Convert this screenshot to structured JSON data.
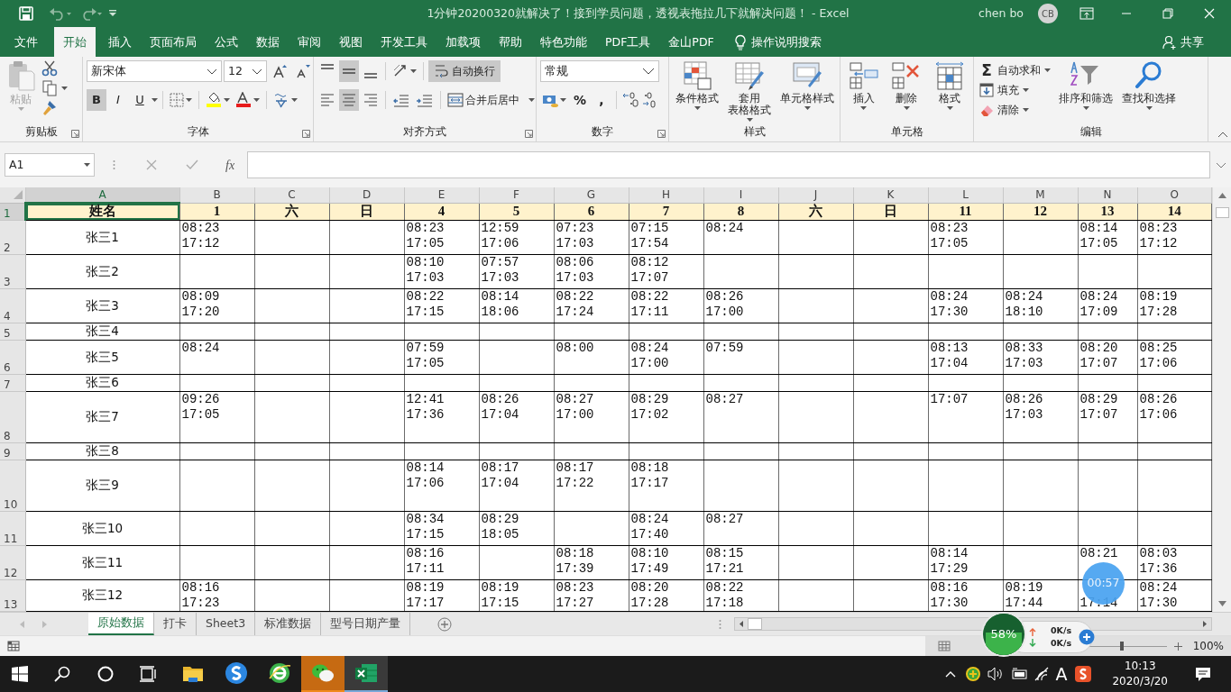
{
  "title_bar": {
    "title": "1分钟20200320就解决了！接到学员问题，透视表拖拉几下就解决问题！  -  Excel",
    "user_name": "chen bo",
    "avatar_initials": "CB"
  },
  "ribbon_tabs": [
    {
      "label": "文件",
      "selected": false
    },
    {
      "label": "开始",
      "selected": true
    },
    {
      "label": "插入",
      "selected": false
    },
    {
      "label": "页面布局",
      "selected": false
    },
    {
      "label": "公式",
      "selected": false
    },
    {
      "label": "数据",
      "selected": false
    },
    {
      "label": "审阅",
      "selected": false
    },
    {
      "label": "视图",
      "selected": false
    },
    {
      "label": "开发工具",
      "selected": false
    },
    {
      "label": "加载项",
      "selected": false
    },
    {
      "label": "帮助",
      "selected": false
    },
    {
      "label": "特色功能",
      "selected": false
    },
    {
      "label": "PDF工具",
      "selected": false
    },
    {
      "label": "金山PDF",
      "selected": false
    }
  ],
  "tell_me": "操作说明搜索",
  "share": "共享",
  "ribbon": {
    "clipboard": {
      "label": "剪贴板",
      "paste": {
        "label": "粘贴",
        "disabled": true
      }
    },
    "font": {
      "label": "字体",
      "font_name": "新宋体",
      "font_size": "12",
      "styles": [
        {
          "label": "B",
          "selected": true
        },
        {
          "label": "I",
          "selected": false
        },
        {
          "label": "U",
          "selected": false
        }
      ]
    },
    "alignment": {
      "label": "对齐方式",
      "vertical": [
        {
          "selected": false
        },
        {
          "selected": true
        },
        {
          "selected": false
        }
      ],
      "horizontal": [
        {
          "selected": false
        },
        {
          "selected": true
        },
        {
          "selected": false
        }
      ],
      "wrap_text": {
        "label": "自动换行",
        "selected": true
      },
      "merge": "合并后居中"
    },
    "number": {
      "label": "数字",
      "format": "常规",
      "symbols": [
        "%",
        ","
      ]
    },
    "styles": {
      "label": "样式",
      "buttons": [
        [
          "条件格式"
        ],
        [
          "套用",
          "表格格式"
        ],
        [
          "单元格样式"
        ]
      ]
    },
    "cells": {
      "label": "单元格",
      "buttons": [
        [
          "插入"
        ],
        [
          "删除"
        ],
        [
          "格式"
        ]
      ]
    },
    "editing": {
      "label": "编辑",
      "small_buttons": [
        {
          "symbol": "Σ",
          "label": "自动求和"
        },
        {
          "label": "填充"
        },
        {
          "label": "清除"
        }
      ],
      "buttons": [
        [
          "排序和筛选"
        ],
        [
          "查找和选择"
        ]
      ]
    }
  },
  "formula_bar": {
    "name_box": "A1",
    "function_label": "fx"
  },
  "sheet": {
    "columns": [
      {
        "letter": "A",
        "selected": true
      },
      {
        "letter": "B",
        "selected": false
      },
      {
        "letter": "C",
        "selected": false
      },
      {
        "letter": "D",
        "selected": false
      },
      {
        "letter": "E",
        "selected": false
      },
      {
        "letter": "F",
        "selected": false
      },
      {
        "letter": "G",
        "selected": false
      },
      {
        "letter": "H",
        "selected": false
      },
      {
        "letter": "I",
        "selected": false
      },
      {
        "letter": "J",
        "selected": false
      },
      {
        "letter": "K",
        "selected": false
      },
      {
        "letter": "L",
        "selected": false
      },
      {
        "letter": "M",
        "selected": false
      },
      {
        "letter": "N",
        "selected": false
      },
      {
        "letter": "O",
        "selected": false
      }
    ],
    "rows": [
      {
        "number": "1",
        "selected": true,
        "kind": "header",
        "cells": [
          [
            "姓名"
          ],
          [
            "1"
          ],
          [
            "六"
          ],
          [
            "日"
          ],
          [
            "4"
          ],
          [
            "5"
          ],
          [
            "6"
          ],
          [
            "7"
          ],
          [
            "8"
          ],
          [
            "六"
          ],
          [
            "日"
          ],
          [
            "11"
          ],
          [
            "12"
          ],
          [
            "13"
          ],
          [
            "14"
          ]
        ]
      },
      {
        "number": "2",
        "selected": false,
        "kind": "data",
        "cells": [
          [
            "张三1"
          ],
          [
            "08:23",
            "17:12"
          ],
          null,
          null,
          [
            "08:23",
            "17:05"
          ],
          [
            "12:59",
            "17:06"
          ],
          [
            "07:23",
            "17:03"
          ],
          [
            "07:15",
            "17:54"
          ],
          [
            "08:24"
          ],
          null,
          null,
          [
            "08:23",
            "17:05"
          ],
          null,
          [
            "08:14",
            "17:05"
          ],
          [
            "08:23",
            "17:12"
          ]
        ]
      },
      {
        "number": "3",
        "selected": false,
        "kind": "data",
        "cells": [
          [
            "张三2"
          ],
          null,
          null,
          null,
          [
            "08:10",
            "17:03"
          ],
          [
            "07:57",
            "17:03"
          ],
          [
            "08:06",
            "17:03"
          ],
          [
            "08:12",
            "17:07"
          ],
          null,
          null,
          null,
          null,
          null,
          null,
          null
        ]
      },
      {
        "number": "4",
        "selected": false,
        "kind": "data",
        "cells": [
          [
            "张三3"
          ],
          [
            "08:09",
            "17:20"
          ],
          null,
          null,
          [
            "08:22",
            "17:15"
          ],
          [
            "08:14",
            "18:06"
          ],
          [
            "08:22",
            "17:24"
          ],
          [
            "08:22",
            "17:11"
          ],
          [
            "08:26",
            "17:00"
          ],
          null,
          null,
          [
            "08:24",
            "17:30"
          ],
          [
            "08:24",
            "18:10"
          ],
          [
            "08:24",
            "17:09"
          ],
          [
            "08:19",
            "17:28"
          ]
        ]
      },
      {
        "number": "5",
        "selected": false,
        "kind": "data",
        "cells": [
          [
            "张三4"
          ],
          null,
          null,
          null,
          null,
          null,
          null,
          null,
          null,
          null,
          null,
          null,
          null,
          null,
          null
        ]
      },
      {
        "number": "6",
        "selected": false,
        "kind": "data",
        "cells": [
          [
            "张三5"
          ],
          [
            "08:24"
          ],
          null,
          null,
          [
            "07:59",
            "17:05"
          ],
          null,
          [
            "08:00"
          ],
          [
            "08:24",
            "17:00"
          ],
          [
            "07:59"
          ],
          null,
          null,
          [
            "08:13",
            "17:04"
          ],
          [
            "08:33",
            "17:03"
          ],
          [
            "08:20",
            "17:07"
          ],
          [
            "08:25",
            "17:06"
          ]
        ]
      },
      {
        "number": "7",
        "selected": false,
        "kind": "data",
        "cells": [
          [
            "张三6"
          ],
          null,
          null,
          null,
          null,
          null,
          null,
          null,
          null,
          null,
          null,
          null,
          null,
          null,
          null
        ]
      },
      {
        "number": "8",
        "selected": false,
        "kind": "data",
        "cells": [
          [
            "张三7"
          ],
          [
            "09:26",
            "17:05"
          ],
          null,
          null,
          [
            "12:41",
            "17:36"
          ],
          [
            "08:26",
            "17:04"
          ],
          [
            "08:27",
            "17:00"
          ],
          [
            "08:29",
            "17:02"
          ],
          [
            "08:27"
          ],
          null,
          null,
          [
            "17:07"
          ],
          [
            "08:26",
            "17:03"
          ],
          [
            "08:29",
            "17:07"
          ],
          [
            "08:26",
            "17:06"
          ]
        ]
      },
      {
        "number": "9",
        "selected": false,
        "kind": "data",
        "cells": [
          [
            "张三8"
          ],
          null,
          null,
          null,
          null,
          null,
          null,
          null,
          null,
          null,
          null,
          null,
          null,
          null,
          null
        ]
      },
      {
        "number": "10",
        "selected": false,
        "kind": "data",
        "cells": [
          [
            "张三9"
          ],
          null,
          null,
          null,
          [
            "08:14",
            "17:06"
          ],
          [
            "08:17",
            "17:04"
          ],
          [
            "08:17",
            "17:22"
          ],
          [
            "08:18",
            "17:17"
          ],
          null,
          null,
          null,
          null,
          null,
          null,
          null
        ]
      },
      {
        "number": "11",
        "selected": false,
        "kind": "data",
        "cells": [
          [
            "张三10"
          ],
          null,
          null,
          null,
          [
            "08:34",
            "17:15"
          ],
          [
            "08:29",
            "18:05"
          ],
          null,
          [
            "08:24",
            "17:40"
          ],
          [
            "08:27"
          ],
          null,
          null,
          null,
          null,
          null,
          null
        ]
      },
      {
        "number": "12",
        "selected": false,
        "kind": "data",
        "cells": [
          [
            "张三11"
          ],
          null,
          null,
          null,
          [
            "08:16",
            "17:11"
          ],
          null,
          [
            "08:18",
            "17:39"
          ],
          [
            "08:10",
            "17:49"
          ],
          [
            "08:15",
            "17:21"
          ],
          null,
          null,
          [
            "08:14",
            "17:29"
          ],
          null,
          [
            "08:21"
          ],
          [
            "08:03",
            "17:36"
          ]
        ]
      },
      {
        "number": "13",
        "selected": false,
        "kind": "data",
        "cells": [
          [
            "张三12"
          ],
          [
            "08:16",
            "17:23"
          ],
          null,
          null,
          [
            "08:19",
            "17:17"
          ],
          [
            "08:19",
            "17:15"
          ],
          [
            "08:23",
            "17:27"
          ],
          [
            "08:20",
            "17:28"
          ],
          [
            "08:22",
            "17:18"
          ],
          null,
          null,
          [
            "08:16",
            "17:30"
          ],
          [
            "08:19",
            "17:44"
          ],
          [
            null,
            "17:14"
          ],
          [
            "08:24",
            "17:30"
          ]
        ]
      }
    ]
  },
  "sheet_tabs": [
    {
      "label": "原始数据",
      "selected": true
    },
    {
      "label": "打卡",
      "selected": false
    },
    {
      "label": "Sheet3",
      "selected": false
    },
    {
      "label": "标准数据",
      "selected": false
    },
    {
      "label": "型号日期产量",
      "selected": false
    }
  ],
  "status_bar": {
    "zoom": "100%",
    "zoom_slider": {
      "level": 0.5
    }
  },
  "overlays": {
    "memory": {
      "reading": "58%",
      "level": 0.55
    },
    "upload": "0K/s",
    "download": "0K/s",
    "timer": "00:57"
  },
  "taskbar": {
    "apps": [
      {
        "kind": "folder",
        "attention": false,
        "selected": false
      },
      {
        "kind": "browser-s",
        "attention": false,
        "selected": false
      },
      {
        "kind": "browser-e",
        "attention": false,
        "selected": false
      },
      {
        "kind": "chat",
        "attention": true,
        "selected": false
      },
      {
        "kind": "spreadsheet",
        "attention": false,
        "selected": true
      }
    ],
    "input_indicator": "A",
    "time": "10:13",
    "date": "2020/3/20"
  }
}
